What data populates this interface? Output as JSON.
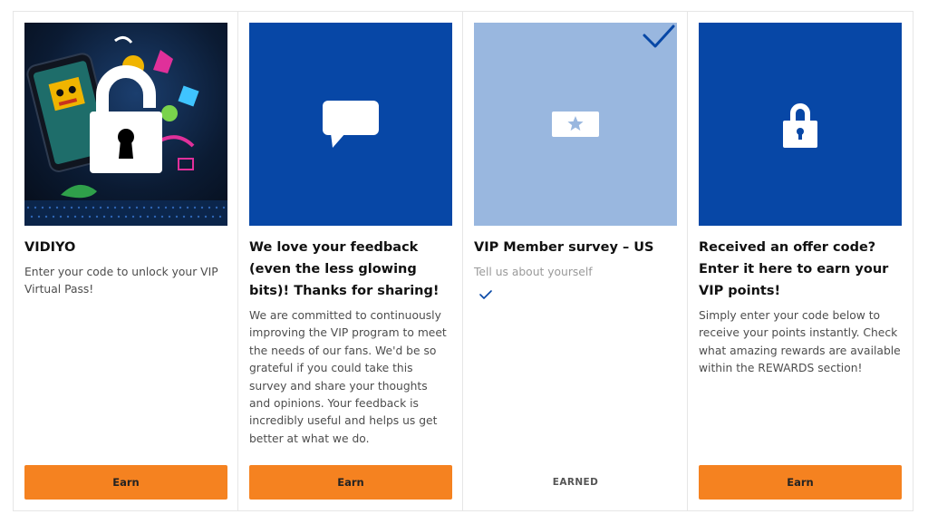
{
  "colors": {
    "brand_blue": "#0747a6",
    "light_blue": "#99b7df",
    "orange": "#f58220"
  },
  "cards": [
    {
      "title": "VIDIYO",
      "description": "Enter your code to unlock your VIP Virtual Pass!",
      "image_icon": "padlock-icon",
      "button_label": "Earn"
    },
    {
      "title": "We love your feedback (even the less glowing bits)! Thanks for sharing!",
      "description": "We are committed to continuously improving the VIP program to meet the needs of our fans. We'd be so grateful if you could take this survey and share your thoughts and opinions. Your feedback is incredibly useful and helps us get better at what we do.",
      "image_icon": "speech-bubble-icon",
      "button_label": "Earn"
    },
    {
      "title": "VIP Member survey – US",
      "description": "Tell us about yourself",
      "image_icon": "star-card-icon",
      "status_label": "EARNED"
    },
    {
      "title": "Received an offer code? Enter it here to earn your VIP points!",
      "description": "Simply enter your code below to receive your points instantly. Check what amazing rewards are available within the REWARDS section!",
      "image_icon": "padlock-icon",
      "button_label": "Earn"
    }
  ]
}
